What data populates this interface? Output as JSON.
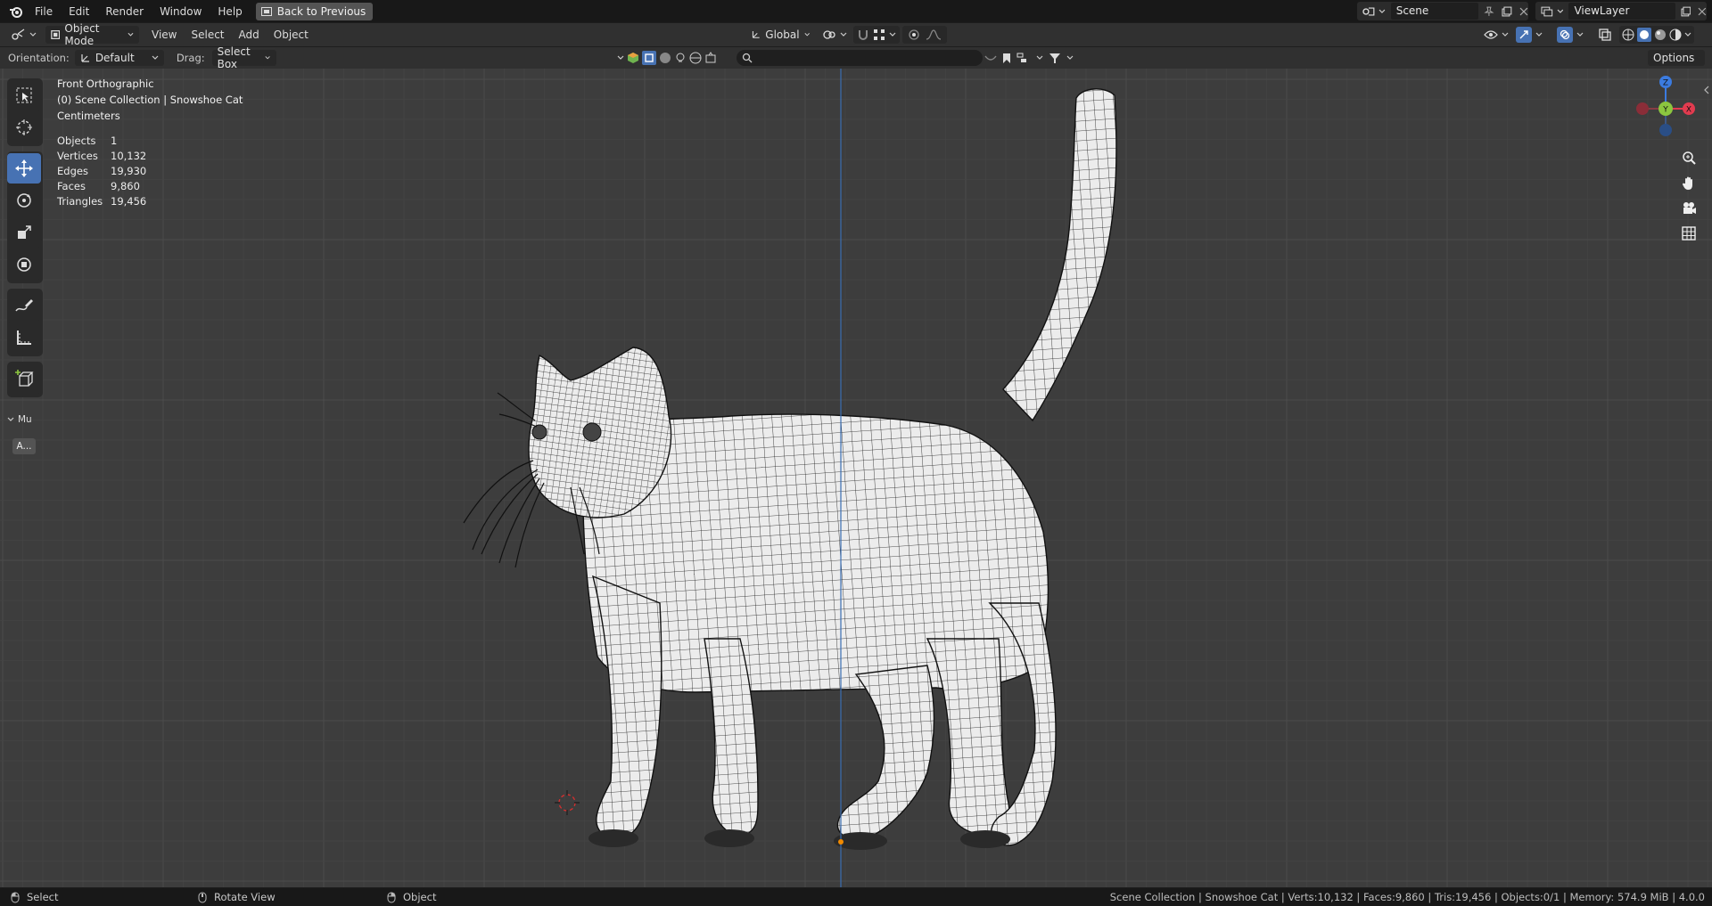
{
  "topbar": {
    "menus": [
      "File",
      "Edit",
      "Render",
      "Window",
      "Help"
    ],
    "back_label": "Back to Previous",
    "scene_name": "Scene",
    "view_layer": "ViewLayer"
  },
  "header": {
    "mode": "Object Mode",
    "menus": [
      "View",
      "Select",
      "Add",
      "Object"
    ],
    "transform_orientation": "Global",
    "options_label": "Options"
  },
  "tool_settings": {
    "orientation_label": "Orientation:",
    "orientation_value": "Default",
    "drag_label": "Drag:",
    "drag_value": "Select Box"
  },
  "viewport": {
    "view_name": "Front Orthographic",
    "collection_line": "(0) Scene Collection | Snowshoe Cat",
    "units": "Centimeters",
    "stats": [
      {
        "label": "Objects",
        "value": "1"
      },
      {
        "label": "Vertices",
        "value": "10,132"
      },
      {
        "label": "Edges",
        "value": "19,930"
      },
      {
        "label": "Faces",
        "value": "9,860"
      },
      {
        "label": "Triangles",
        "value": "19,456"
      }
    ],
    "toolbar_collapsed_label": "Mu",
    "toolbar_button_label": "A...",
    "gizmo_axes": {
      "z": "Z",
      "y": "Y",
      "x": "X"
    }
  },
  "statusbar": {
    "hints": [
      "Select",
      "Rotate View",
      "Object"
    ],
    "info": "Scene Collection | Snowshoe Cat | Verts:10,132 | Faces:9,860 | Tris:19,456 | Objects:0/1 | Memory: 574.9 MiB | 4.0.0"
  },
  "colors": {
    "accent": "#4772b3",
    "viewport_bg": "#3d3d3d",
    "axis_x": "#e23b4f",
    "axis_y": "#8cc63f",
    "axis_z": "#3b7be0"
  }
}
